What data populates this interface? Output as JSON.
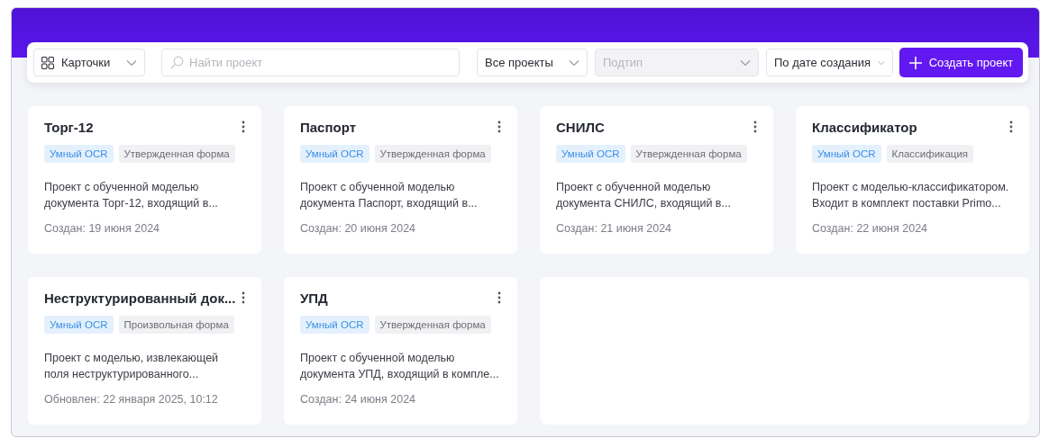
{
  "toolbar": {
    "view_select": {
      "label": "Карточки"
    },
    "search": {
      "placeholder": "Найти проект"
    },
    "filters": [
      {
        "label": "Все проекты",
        "disabled": false
      },
      {
        "label": "Подтип",
        "disabled": true
      },
      {
        "label": "По дате создания",
        "disabled": false
      }
    ],
    "create_button": {
      "label": "Создать проект"
    }
  },
  "cards": [
    {
      "title": "Торг-12",
      "tags": [
        {
          "label": "Умный OCR",
          "kind": "ocr"
        },
        {
          "label": "Утвержденная форма",
          "kind": "type"
        }
      ],
      "description": "Проект с обученной моделью документа Торг-12, входящий в...",
      "date": "Создан: 19 июня 2024"
    },
    {
      "title": "Паспорт",
      "tags": [
        {
          "label": "Умный OCR",
          "kind": "ocr"
        },
        {
          "label": "Утвержденная форма",
          "kind": "type"
        }
      ],
      "description": "Проект с обученной моделью документа Паспорт, входящий в...",
      "date": "Создан: 20 июня 2024"
    },
    {
      "title": "СНИЛС",
      "tags": [
        {
          "label": "Умный OCR",
          "kind": "ocr"
        },
        {
          "label": "Утвержденная форма",
          "kind": "type"
        }
      ],
      "description": "Проект с обученной моделью документа СНИЛС, входящий в...",
      "date": "Создан: 21 июня 2024"
    },
    {
      "title": "Классификатор",
      "tags": [
        {
          "label": "Умный OCR",
          "kind": "ocr"
        },
        {
          "label": "Классификация",
          "kind": "type"
        }
      ],
      "description": "Проект с моделью-классификатором. Входит в комплект поставки Primo...",
      "date": "Создан: 22 июня 2024"
    },
    {
      "title": "Неструктурированный док...",
      "tags": [
        {
          "label": "Умный OCR",
          "kind": "ocr"
        },
        {
          "label": "Произвольная форма",
          "kind": "type"
        }
      ],
      "description": "Проект с моделью, извлекающей поля неструктурированного...",
      "date": "Обновлен: 22 января 2025, 10:12"
    },
    {
      "title": "УПД",
      "tags": [
        {
          "label": "Умный OCR",
          "kind": "ocr"
        },
        {
          "label": "Утвержденная форма",
          "kind": "type"
        }
      ],
      "description": "Проект с обученной моделью документа УПД, входящий в компле...",
      "date": "Создан: 24 июня 2024"
    }
  ]
}
